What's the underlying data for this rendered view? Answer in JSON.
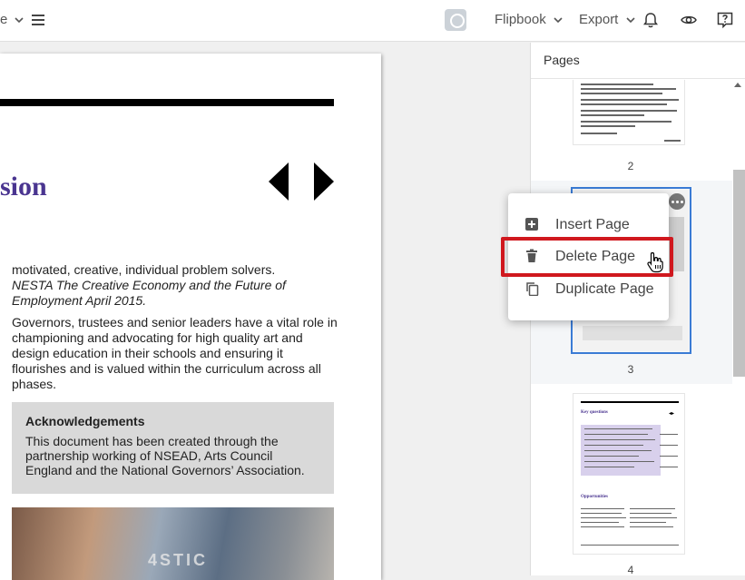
{
  "toolbar": {
    "left_fragment": "e",
    "flipbook_label": "Flipbook",
    "export_label": "Export"
  },
  "document": {
    "title_fragment": "sion",
    "para1_line1": "motivated, creative, individual problem solvers.",
    "para1_italic": "NESTA The Creative Economy and the Future of Employment April 2015.",
    "para2": "Governors, trustees and senior leaders have a vital role in championing and advocating for high quality art and design education in their schools and ensuring it flourishes and is valued within the curriculum across all phases.",
    "ack_title": "Acknowledgements",
    "ack_text": "This document has been created through the partnership working of NSEAD, Arts Council England and the National Governors’ Association.",
    "photo_text": "4STIC"
  },
  "panel": {
    "title": "Pages",
    "pages": [
      {
        "number": "2"
      },
      {
        "number": "3",
        "selected": true
      },
      {
        "number": "4"
      }
    ],
    "page4_heading1": "Key questions",
    "page4_heading2": "Opportunities"
  },
  "context_menu": {
    "items": [
      {
        "label": "Insert Page",
        "icon": "plus-square-icon"
      },
      {
        "label": "Delete Page",
        "icon": "trash-icon",
        "highlighted": true
      },
      {
        "label": "Duplicate Page",
        "icon": "copy-icon"
      }
    ]
  },
  "colors": {
    "accent": "#3a7bd5",
    "highlight": "#d0181e",
    "doc_title": "#4a3590"
  }
}
